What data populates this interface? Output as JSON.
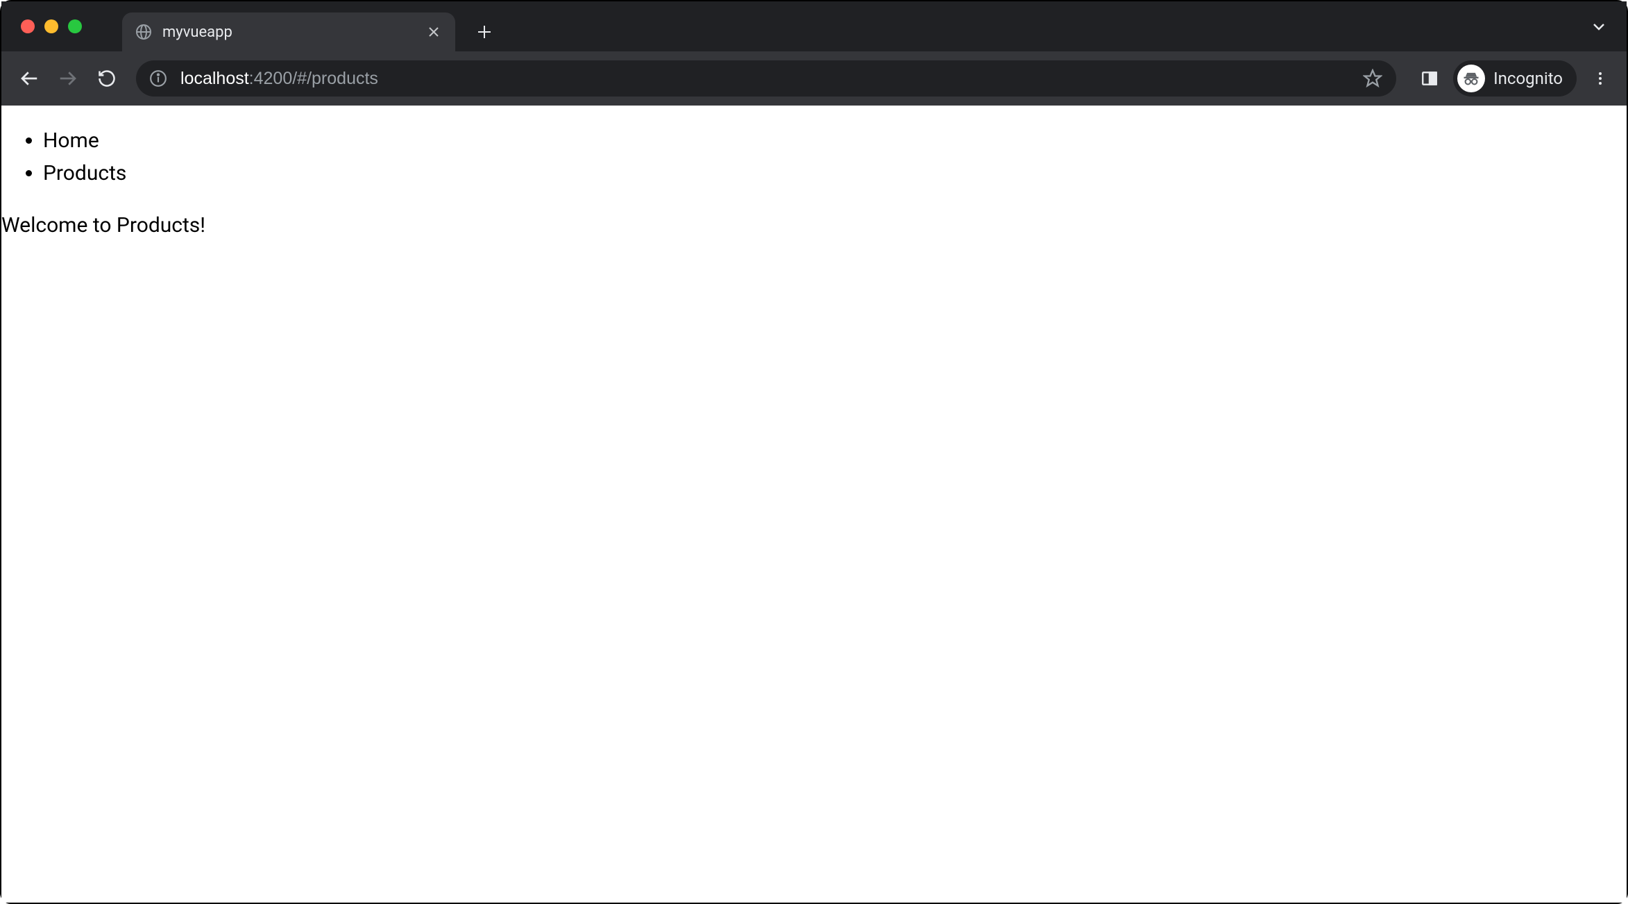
{
  "browser": {
    "tab": {
      "title": "myvueapp"
    },
    "url": {
      "host": "localhost",
      "path": ":4200/#/products"
    },
    "incognito_label": "Incognito"
  },
  "page": {
    "nav": [
      {
        "label": "Home"
      },
      {
        "label": "Products"
      }
    ],
    "welcome_text": "Welcome to Products!"
  }
}
